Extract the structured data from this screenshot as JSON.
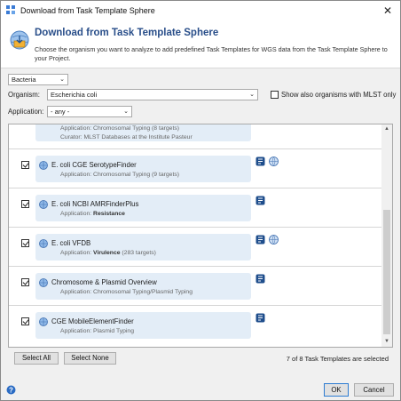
{
  "window": {
    "title": "Download from Task Template Sphere",
    "close_glyph": "✕"
  },
  "header": {
    "title": "Download from Task Template Sphere",
    "description": "Choose the organism you want to analyze to add predefined Task Templates for WGS data from the Task Template Sphere to your Project."
  },
  "filters": {
    "kingdom": "Bacteria",
    "organism_label": "Organism:",
    "organism": "Escherichia coli",
    "mlst_only_label": "Show also organisms with MLST only",
    "mlst_only_checked": false,
    "application_label": "Application:",
    "application": "- any -"
  },
  "templates": [
    {
      "name": "",
      "app_prefix": "Application: ",
      "app": "Chromosomal Typing (8 targets)",
      "app_bold": false,
      "extra": "Curator: MLST Databases at the Institute Pasteur",
      "checked": false,
      "partial": true
    },
    {
      "name": "E. coli CGE SerotypeFinder",
      "app_prefix": "Application: ",
      "app": "Chromosomal Typing (9 targets)",
      "app_bold": false,
      "checked": true,
      "icons": [
        "template-icon",
        "web-icon"
      ]
    },
    {
      "name": "E. coli NCBI AMRFinderPlus",
      "app_prefix": "Application: ",
      "app": "Resistance",
      "app_bold": true,
      "checked": true,
      "icons": [
        "template-icon"
      ]
    },
    {
      "name": "E. coli VFDB",
      "app_prefix": "Application: ",
      "app": "Virulence",
      "app_suffix": " (283 targets)",
      "app_bold": true,
      "checked": true,
      "icons": [
        "template-icon",
        "web-icon"
      ]
    },
    {
      "name": "Chromosome & Plasmid Overview",
      "app_prefix": "Application: ",
      "app": "Chromosomal Typing/Plasmid Typing",
      "app_bold": false,
      "checked": true,
      "icons": [
        "template-icon"
      ]
    },
    {
      "name": "CGE MobileElementFinder",
      "app_prefix": "Application: ",
      "app": "Plasmid Typing",
      "app_bold": false,
      "checked": true,
      "icons": [
        "template-icon"
      ]
    }
  ],
  "buttons": {
    "select_all": "Select All",
    "select_none": "Select None",
    "ok": "OK",
    "cancel": "Cancel"
  },
  "status": "7 of 8 Task Templates are selected",
  "colors": {
    "title_blue": "#2a4f8a",
    "card_bg": "#e3edf7",
    "focus_border": "#2d7cd1"
  }
}
